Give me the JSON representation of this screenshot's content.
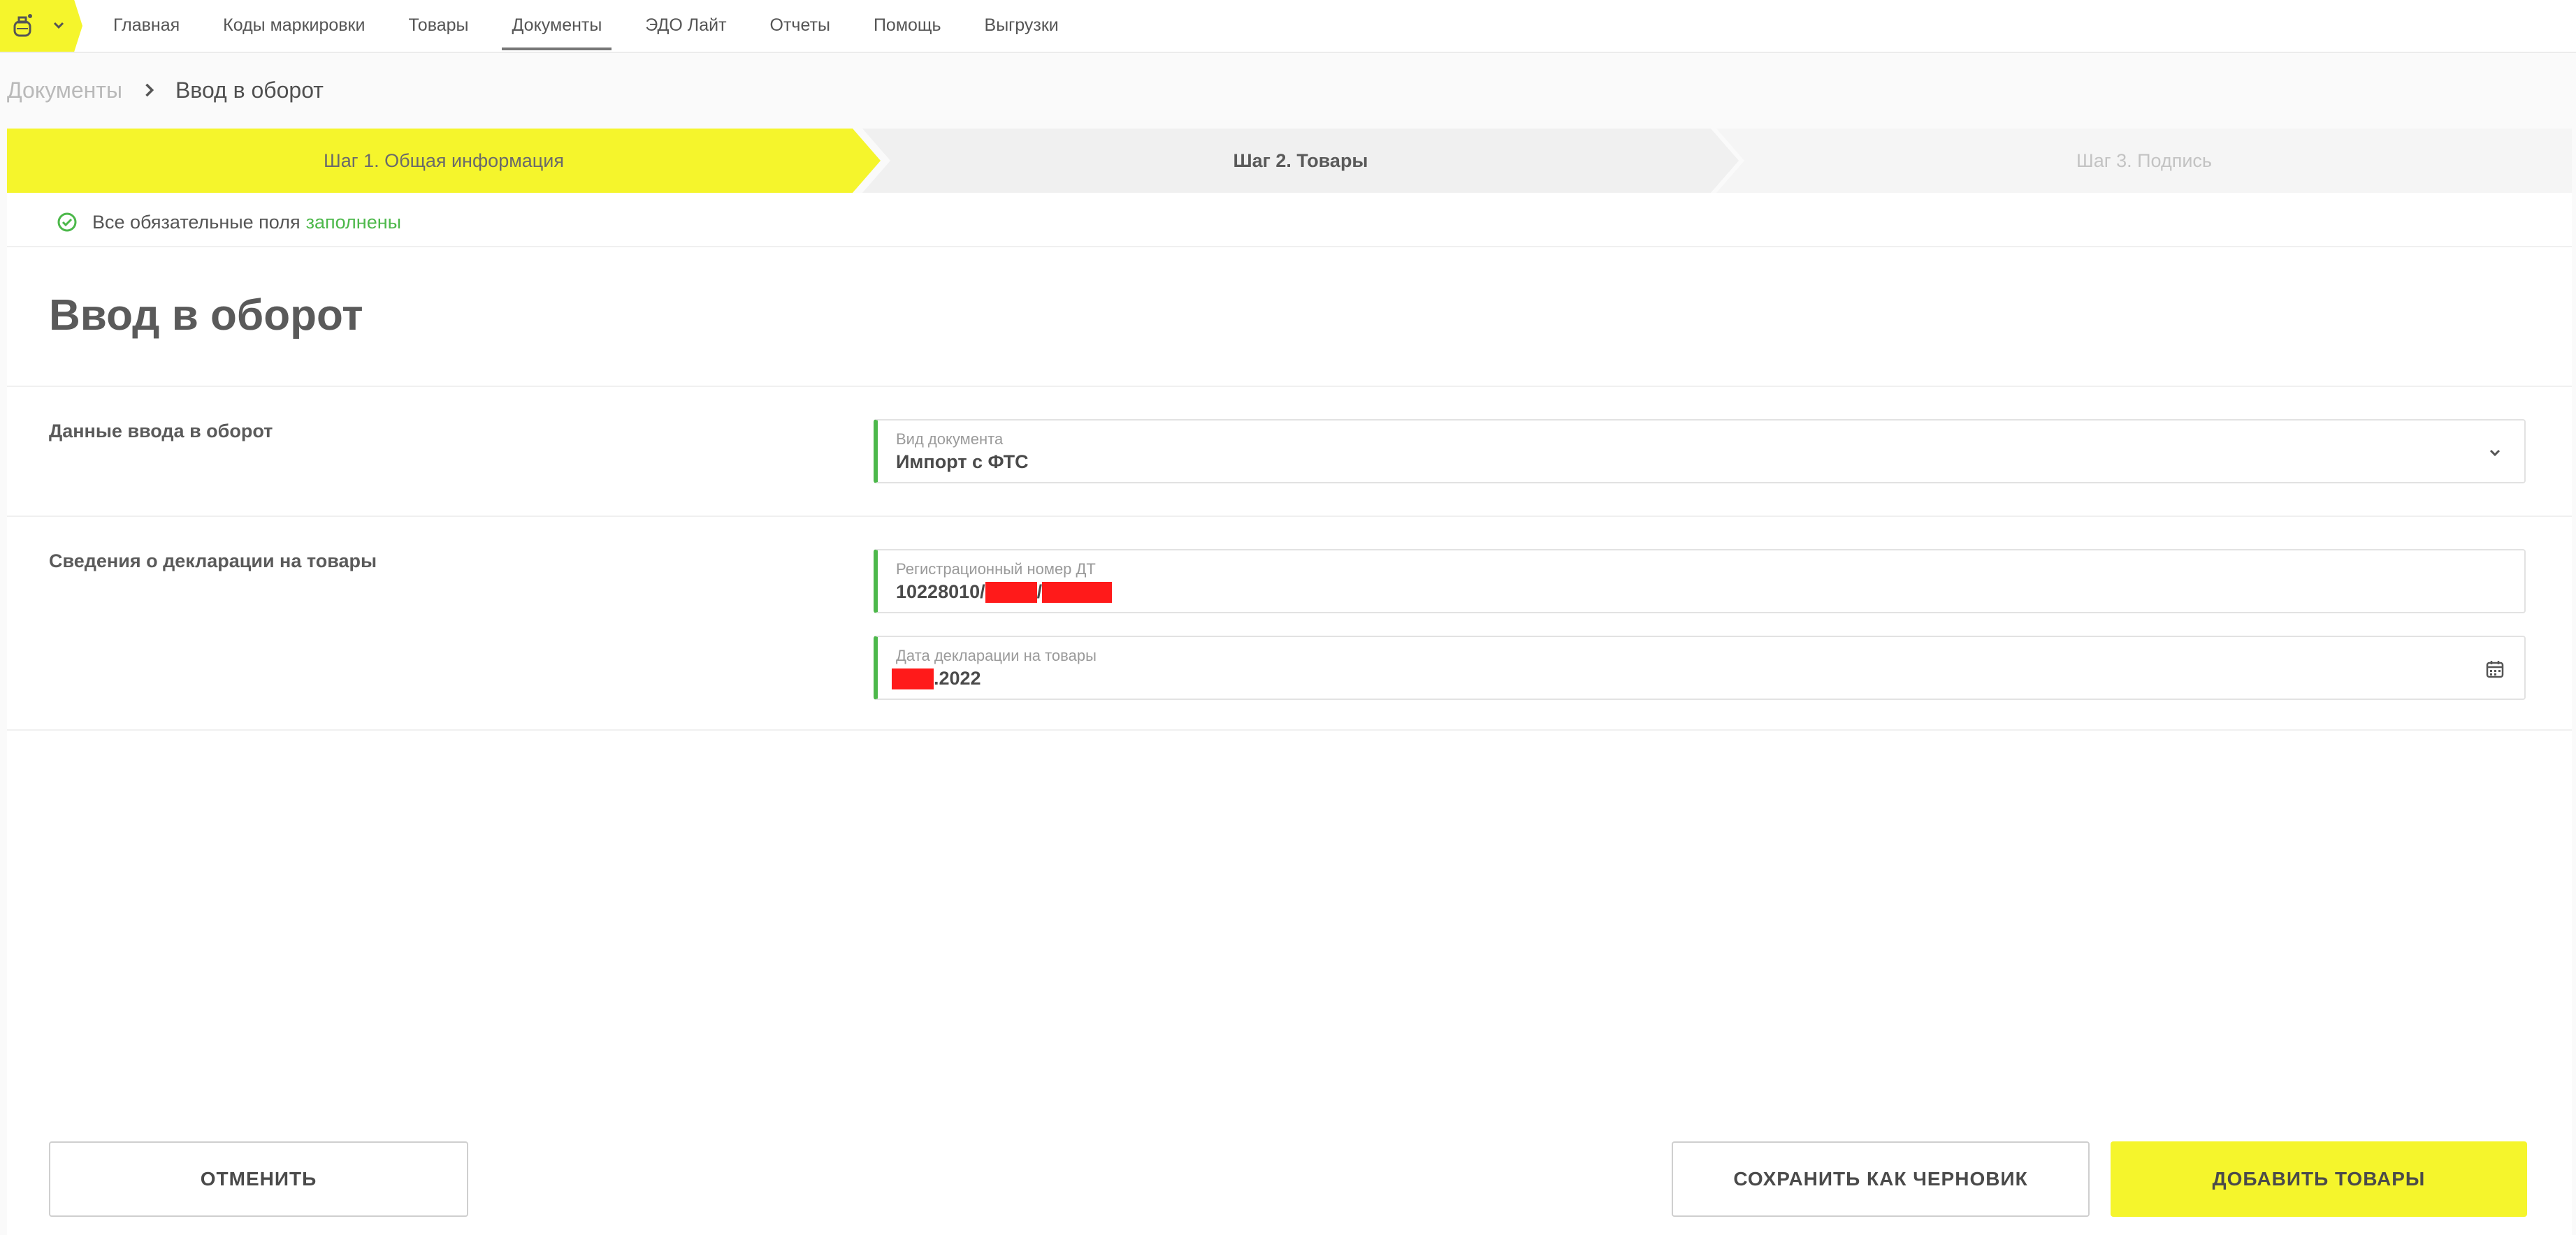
{
  "nav": {
    "items": [
      {
        "label": "Главная",
        "active": false
      },
      {
        "label": "Коды маркировки",
        "active": false
      },
      {
        "label": "Товары",
        "active": false
      },
      {
        "label": "Документы",
        "active": true
      },
      {
        "label": "ЭДО Лайт",
        "active": false
      },
      {
        "label": "Отчеты",
        "active": false
      },
      {
        "label": "Помощь",
        "active": false
      },
      {
        "label": "Выгрузки",
        "active": false
      }
    ]
  },
  "breadcrumb": {
    "parent": "Документы",
    "current": "Ввод в оборот"
  },
  "steps": [
    {
      "label": "Шаг 1. Общая информация",
      "state": "active"
    },
    {
      "label": "Шаг 2. Товары",
      "state": "next"
    },
    {
      "label": "Шаг 3. Подпись",
      "state": "disabled"
    }
  ],
  "status": {
    "text": "Все обязательные поля",
    "highlight": "заполнены"
  },
  "page_title": "Ввод в оборот",
  "sections": {
    "entry_data": {
      "label": "Данные ввода в оборот",
      "doc_type_label": "Вид документа",
      "doc_type_value": "Импорт с ФТС"
    },
    "declaration": {
      "label": "Сведения о декларации на товары",
      "reg_number_label": "Регистрационный номер ДТ",
      "reg_number_prefix": "10228010/",
      "reg_number_sep": "/",
      "date_label": "Дата декларации на товары",
      "date_suffix": ".2022"
    }
  },
  "buttons": {
    "cancel": "ОТМЕНИТЬ",
    "save_draft": "СОХРАНИТЬ КАК ЧЕРНОВИК",
    "add_goods": "ДОБАВИТЬ ТОВАРЫ"
  },
  "colors": {
    "accent_yellow": "#f5f52c",
    "success_green": "#4cb84a",
    "redaction_red": "#ff1a1a"
  }
}
